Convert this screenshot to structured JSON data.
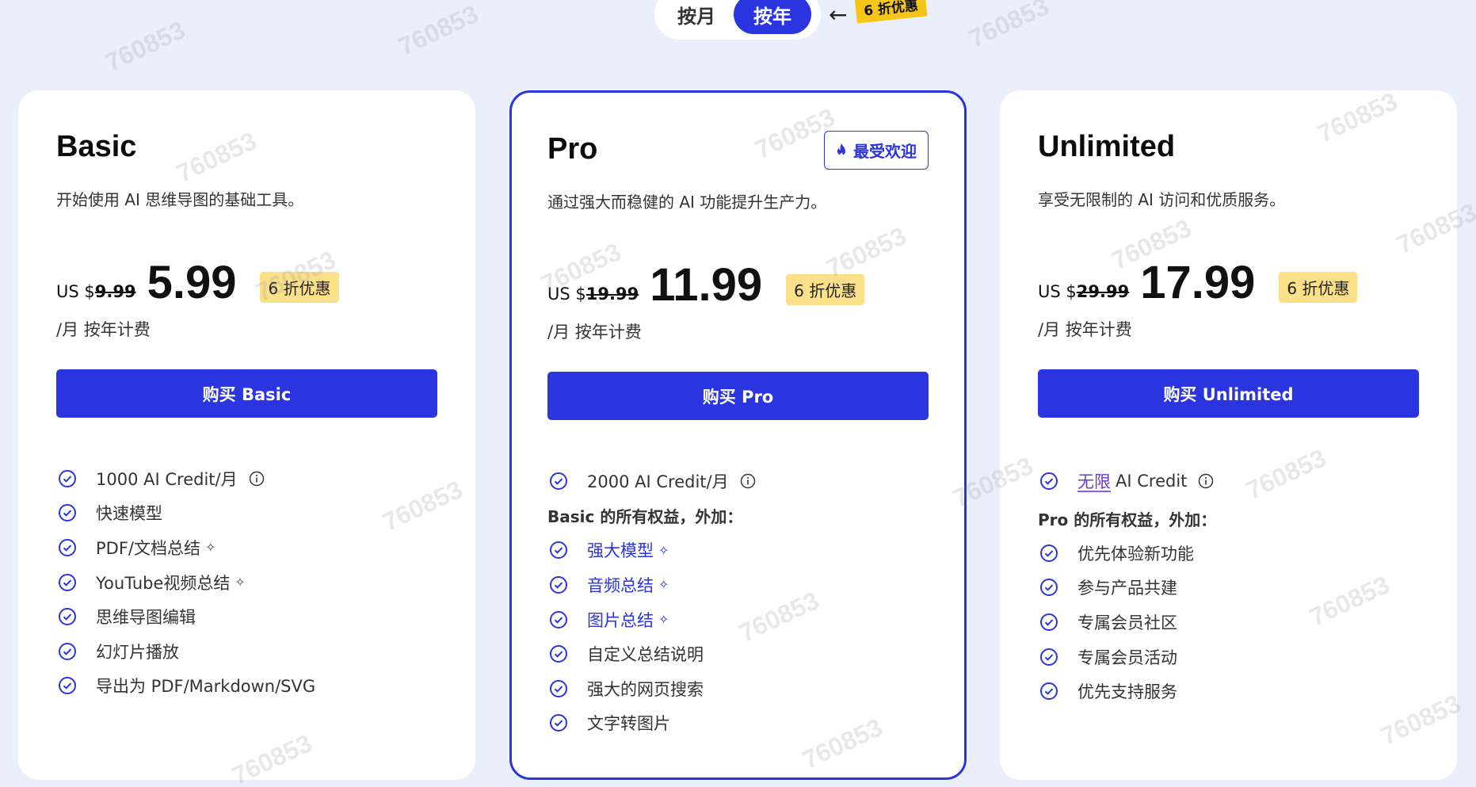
{
  "toggle": {
    "monthly_label": "按月",
    "yearly_label": "按年",
    "arrow": "←",
    "discount_tag": "6 折优惠"
  },
  "watermark": "760853",
  "plans": [
    {
      "name": "Basic",
      "description": "开始使用 AI 思维导图的基础工具。",
      "currency_prefix": "US $",
      "original_price": "9.99",
      "price": "5.99",
      "discount": "6 折优惠",
      "billing": "/月 按年计费",
      "buy_label": "购买 Basic",
      "features": [
        {
          "text": "1000 AI Credit/月",
          "info": true
        },
        {
          "text": "快速模型"
        },
        {
          "text": "PDF/文档总结",
          "spark": true
        },
        {
          "text": "YouTube视频总结",
          "spark": true
        },
        {
          "text": "思维导图编辑"
        },
        {
          "text": "幻灯片播放"
        },
        {
          "text": "导出为 PDF/Markdown/SVG"
        }
      ]
    },
    {
      "name": "Pro",
      "badge": "最受欢迎",
      "description": "通过强大而稳健的 AI 功能提升生产力。",
      "currency_prefix": "US $",
      "original_price": "19.99",
      "price": "11.99",
      "discount": "6 折优惠",
      "billing": "/月 按年计费",
      "buy_label": "购买 Pro",
      "credit": "2000 AI Credit/月",
      "extra_heading": "Basic 的所有权益，外加：",
      "features": [
        {
          "text": "强大模型",
          "spark": true,
          "highlight": true
        },
        {
          "text": "音频总结",
          "spark": true,
          "highlight": true
        },
        {
          "text": "图片总结",
          "spark": true,
          "highlight": true
        },
        {
          "text": "自定义总结说明"
        },
        {
          "text": "强大的网页搜索"
        },
        {
          "text": "文字转图片"
        }
      ]
    },
    {
      "name": "Unlimited",
      "description": "享受无限制的 AI 访问和优质服务。",
      "currency_prefix": "US $",
      "original_price": "29.99",
      "price": "17.99",
      "discount": "6 折优惠",
      "billing": "/月 按年计费",
      "buy_label": "购买 Unlimited",
      "credit_highlight": "无限",
      "credit_rest": "AI Credit",
      "extra_heading": "Pro 的所有权益，外加：",
      "features": [
        {
          "text": "优先体验新功能"
        },
        {
          "text": "参与产品共建"
        },
        {
          "text": "专属会员社区"
        },
        {
          "text": "专属会员活动"
        },
        {
          "text": "优先支持服务"
        }
      ]
    }
  ],
  "colors": {
    "accent": "#2a35e0",
    "background": "#e9f0fb",
    "discount_bg": "#fbe08a",
    "tag_yellow": "#f5c518"
  }
}
